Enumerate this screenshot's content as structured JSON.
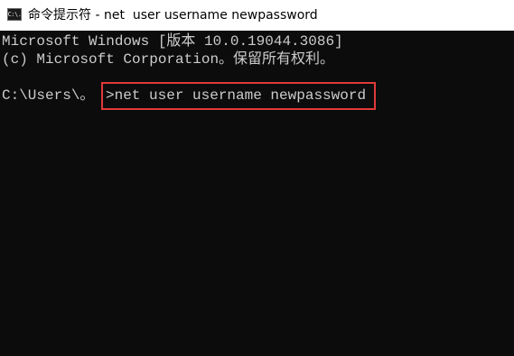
{
  "window": {
    "title": "命令提示符 - net  user username newpassword",
    "icon": "cmd-icon",
    "icon_text": "C:\\."
  },
  "console": {
    "lines": [
      "Microsoft Windows [版本 10.0.19044.3086]",
      "(c) Microsoft Corporation。保留所有权利。"
    ],
    "prompt": "C:\\Users\\。",
    "command": ">net user username newpassword"
  },
  "colors": {
    "background": "#0c0c0c",
    "text": "#cccccc",
    "highlight_border": "#e03a3a"
  }
}
